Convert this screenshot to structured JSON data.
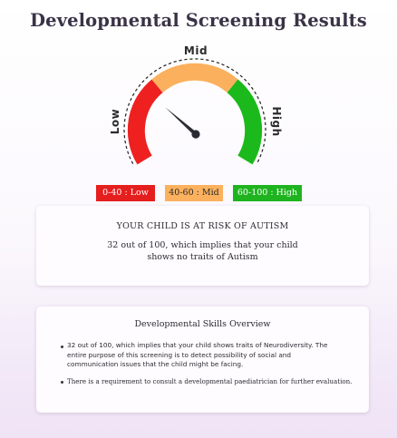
{
  "page": {
    "title": "Developmental Screening Results"
  },
  "gauge": {
    "labels": {
      "low": "Low",
      "mid": "Mid",
      "high": "High"
    },
    "segments": [
      {
        "name": "low",
        "color": "#ee2020"
      },
      {
        "name": "mid",
        "color": "#fbb05d"
      },
      {
        "name": "high",
        "color": "#1bb91b"
      }
    ],
    "score": 32,
    "max": 100
  },
  "legend": [
    {
      "label": "0-40 : Low",
      "bg": "#e51e1e",
      "fg": "#ffffff"
    },
    {
      "label": "40-60 : Mid",
      "bg": "#fbb15e",
      "fg": "#2b2b2b"
    },
    {
      "label": "60-100 : High",
      "bg": "#1fb41f",
      "fg": "#ffffff"
    }
  ],
  "status_card": {
    "heading": "YOUR CHILD IS AT RISK OF AUTISM",
    "line1": "32 out of 100, which implies that your child",
    "line2": "shows no traits of Autism"
  },
  "skills_card": {
    "title": "Developmental Skills Overview",
    "bullet1": {
      "line1": "32 out of 100, which implies that your child shows  traits of Neurodiversity. The",
      "line2": "entire purpose of this screening is to detect possibility  of social and",
      "line3": "communication issues that the child might be facing."
    },
    "bullet2": "There is a requirement to consult a developmental paediatrician for further evaluation."
  }
}
